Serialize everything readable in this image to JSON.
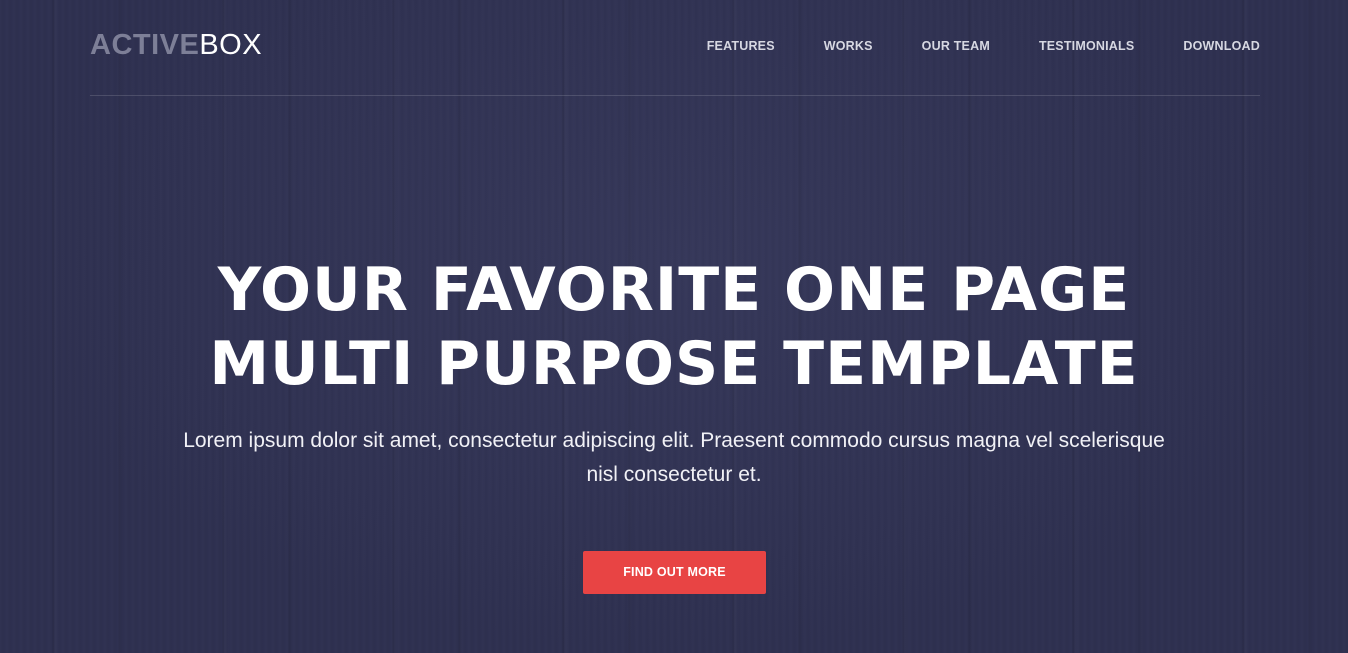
{
  "brand": {
    "logo_bold": "ACTIVE",
    "logo_light": "BOX"
  },
  "nav": {
    "items": [
      {
        "label": "FEATURES"
      },
      {
        "label": "WORKS"
      },
      {
        "label": "OUR TEAM"
      },
      {
        "label": "TESTIMONIALS"
      },
      {
        "label": "DOWNLOAD"
      }
    ]
  },
  "hero": {
    "headline_line1": "YOUR FAVORITE ONE PAGE",
    "headline_line2": "MULTI PURPOSE TEMPLATE",
    "subtext": "Lorem ipsum dolor sit amet, consectetur adipiscing elit. Praesent commodo cursus magna vel scelerisque nisl consectetur et.",
    "cta_label": "FIND OUT MORE"
  },
  "colors": {
    "background": "#2e3050",
    "accent": "#e84444",
    "logo_muted": "#7d7f97",
    "text": "#ffffff"
  }
}
